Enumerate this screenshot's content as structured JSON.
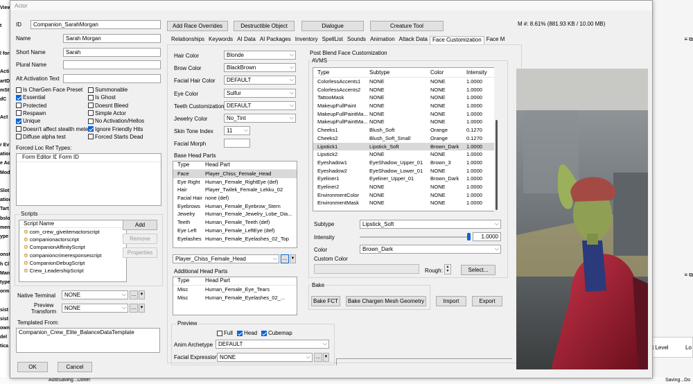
{
  "background": {
    "left_fragments": [
      "View",
      "",
      "t",
      "",
      "",
      "l form",
      "",
      "Acti",
      "artD",
      "mSty",
      "dC",
      "",
      "Act",
      "",
      "",
      "r Ev",
      "ation",
      "e Ac",
      "Mod",
      "",
      "Slot",
      "ation",
      "Tart",
      "bslo",
      "ment",
      "ype",
      "",
      "onst",
      "h Cl",
      "Man",
      "type",
      "orm",
      "",
      "sist",
      "sist",
      "ownS",
      "del",
      "tica"
    ],
    "status_left": "AutoSaving...Done!",
    "status_right": "Saving...Do",
    "right_label1": "t Level",
    "right_label2": "Lo"
  },
  "window": {
    "title": "Actor",
    "memory": "M #: 8.61% (881.93 KB / 10.00 MB)"
  },
  "form": {
    "id_label": "ID",
    "id_value": "Companion_SarahMorgan",
    "name_label": "Name",
    "name_value": "Sarah Morgan",
    "short_name_label": "Short Name",
    "short_name_value": "Sarah",
    "plural_label": "Plural Name",
    "plural_value": "",
    "alt_label": "Alt Activation Text",
    "alt_value": ""
  },
  "flags_left": [
    {
      "label": "Is CharGen Face Preset",
      "checked": false
    },
    {
      "label": "Essential",
      "checked": true
    },
    {
      "label": "Protected",
      "checked": false
    },
    {
      "label": "Respawn",
      "checked": false
    },
    {
      "label": "Unique",
      "checked": true
    },
    {
      "label": "Doesn't affect stealth meter",
      "checked": false
    },
    {
      "label": "Diffuse alpha test",
      "checked": false
    }
  ],
  "flags_right": [
    {
      "label": "Summonable",
      "checked": false
    },
    {
      "label": "Is Ghost",
      "checked": false
    },
    {
      "label": "Doesnt Bleed",
      "checked": false
    },
    {
      "label": "Simple Actor",
      "checked": false
    },
    {
      "label": "No Activation/Hellos",
      "checked": false
    },
    {
      "label": "Ignore Friendly Hits",
      "checked": true
    },
    {
      "label": "Forced Starts Dead",
      "checked": false
    }
  ],
  "forced_loc": {
    "label": "Forced Loc Ref Types:",
    "col1": "Form Editor ID",
    "col2": "Form ID"
  },
  "scripts": {
    "label": "Scripts",
    "header": "Script Name",
    "items": [
      "com_crew_giveitemactorscript",
      "companionactorscript",
      "CompanionAffinityScript",
      "companioncrimeresponsescript",
      "CompanionDebugScript",
      "Crew_LeadershipScript"
    ],
    "add": "Add",
    "remove": "Remove",
    "properties": "Properties"
  },
  "native_terminal": {
    "label": "Native Terminal",
    "value": "NONE"
  },
  "preview_transform": {
    "label": "Preview Transform",
    "value": "NONE"
  },
  "templated": {
    "label": "Templated From:",
    "value": "Companion_Crew_Elite_BalanceDataTemplate"
  },
  "ok": "OK",
  "cancel": "Cancel",
  "top_buttons": [
    "Add Race Overrides",
    "Destructible Object",
    "Dialogue",
    "Creature Tool"
  ],
  "tabs": [
    "Relationships",
    "Keywords",
    "AI Data",
    "AI Packages",
    "Inventory",
    "SpellList",
    "Sounds",
    "Animation",
    "Attack Data",
    "Face Customization",
    "Face M"
  ],
  "active_tab": "Face Customization",
  "face": {
    "hair_color": {
      "label": "Hair Color",
      "value": "Blonde"
    },
    "brow_color": {
      "label": "Brow Color",
      "value": "BlackBrown"
    },
    "facial_hair": {
      "label": "Facial Hair Color",
      "value": "DEFAULT"
    },
    "eye_color": {
      "label": "Eye Color",
      "value": "Sulfur"
    },
    "teeth": {
      "label": "Teeth Customization",
      "value": "DEFAULT"
    },
    "jewelry": {
      "label": "Jewelry Color",
      "value": "No_Tint"
    },
    "skin_tone": {
      "label": "Skin Tone Index",
      "value": "11"
    },
    "facial_morph": {
      "label": "Facial Morph",
      "value": ""
    }
  },
  "base_head": {
    "label": "Base Head Parts",
    "col1": "Type",
    "col2": "Head Part",
    "rows": [
      [
        "Face",
        "Player_Chiss_Female_Head"
      ],
      [
        "Eye Right",
        "Human_Female_RightEye (def)"
      ],
      [
        "Hair",
        "Player_Twilek_Female_Lekku_02"
      ],
      [
        "Facial Hair",
        "none (def)"
      ],
      [
        "Eyebrows",
        "Human_Female_Eyebrow_Stern"
      ],
      [
        "Jewelry",
        "Human_Female_Jewelry_Lobe_Dia..."
      ],
      [
        "Teeth",
        "Human_Female_Teeth (def)"
      ],
      [
        "Eye Left",
        "Human_Female_LeftEye (def)"
      ],
      [
        "Eyelashes",
        "Human_Female_Eyelashes_02_Top"
      ]
    ],
    "selected": "Player_Chiss_Female_Head"
  },
  "additional_head": {
    "label": "Additional Head Parts",
    "col1": "Type",
    "col2": "Head Part",
    "rows": [
      [
        "Misc",
        "Human_Female_Eye_Tears"
      ],
      [
        "Misc",
        "Human_Female_Eyelashes_02_..."
      ]
    ]
  },
  "preview": {
    "label": "Preview",
    "full": {
      "label": "Full",
      "checked": false
    },
    "head": {
      "label": "Head",
      "checked": true
    },
    "cubemap": {
      "label": "Cubemap",
      "checked": true
    },
    "anim_label": "Anim Archetype",
    "anim_value": "DEFAULT",
    "expr_label": "Facial Expression",
    "expr_value": "NONE"
  },
  "post_blend": {
    "label": "Post Blend Face Customization",
    "avms": "AVMS",
    "cols": [
      "Type",
      "Subtype",
      "Color",
      "Intensity"
    ],
    "rows": [
      [
        "ColorlessAccents1",
        "NONE",
        "NONE",
        "1.0000"
      ],
      [
        "ColorlessAccents2",
        "NONE",
        "NONE",
        "1.0000"
      ],
      [
        "TattooMask",
        "NONE",
        "NONE",
        "1.0000"
      ],
      [
        "MakeupFullPaint",
        "NONE",
        "NONE",
        "1.0000"
      ],
      [
        "MakeupFullPaintMa...",
        "NONE",
        "NONE",
        "1.0000"
      ],
      [
        "MakeupFullPaintMa...",
        "NONE",
        "NONE",
        "1.0000"
      ],
      [
        "Cheeks1",
        "Blush_Soft",
        "Orange",
        "0.1270"
      ],
      [
        "Cheeks2",
        "Blush_Soft_Small",
        "Orange",
        "0.1270"
      ],
      [
        "Lipstick1",
        "Lipstick_Soft",
        "Brown_Dark",
        "1.0000"
      ],
      [
        "Lipstick2",
        "NONE",
        "NONE",
        "1.0000"
      ],
      [
        "Eyeshadow1",
        "EyeShadow_Upper_01",
        "Brown_3",
        "1.0000"
      ],
      [
        "Eyeshadow2",
        "EyeShadow_Lower_01",
        "NONE",
        "1.0000"
      ],
      [
        "Eyeliner1",
        "Eyeliner_Upper_01",
        "Brown_Dark",
        "1.0000"
      ],
      [
        "Eyeliner2",
        "NONE",
        "NONE",
        "1.0000"
      ],
      [
        "EnvironmentColor",
        "NONE",
        "NONE",
        "1.0000"
      ],
      [
        "EnvironmentMask",
        "NONE",
        "NONE",
        "1.0000"
      ]
    ],
    "selected_index": 8,
    "subtype_label": "Subtype",
    "subtype_value": "Lipstick_Soft",
    "intensity_label": "Intensity",
    "intensity_value": "1.0000",
    "intensity_fraction": 1.0,
    "color_label": "Color",
    "color_value": "Brown_Dark",
    "custom_color_label": "Custom Color",
    "rough_label": "Rough:",
    "select_btn": "Select..."
  },
  "bake": {
    "label": "Bake",
    "bake_fct": "Bake FCT",
    "bake_chargen": "Bake Chargen Mesh Geometry",
    "import": "Import",
    "export": "Export"
  },
  "ellipsis": "...",
  "colors": {
    "check_blue": "#0a64d8",
    "selected_row": "#d9d9d9"
  }
}
